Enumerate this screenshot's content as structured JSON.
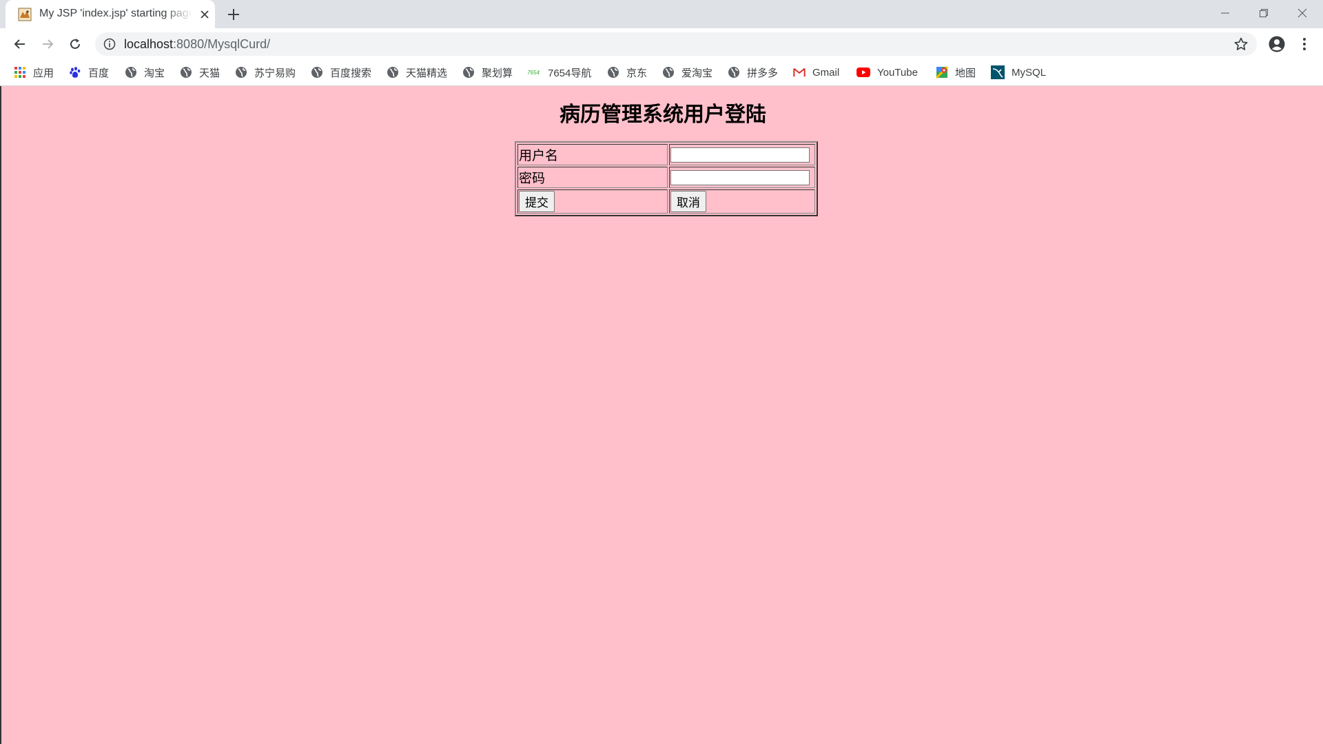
{
  "browser": {
    "tab": {
      "title": "My JSP 'index.jsp' starting page"
    },
    "address": {
      "host": "localhost",
      "path": ":8080/MysqlCurd/"
    },
    "bookmarks": [
      {
        "label": "应用",
        "icon": "apps-grid-icon"
      },
      {
        "label": "百度",
        "icon": "baidu-paw-icon"
      },
      {
        "label": "淘宝",
        "icon": "globe-icon"
      },
      {
        "label": "天猫",
        "icon": "globe-icon"
      },
      {
        "label": "苏宁易购",
        "icon": "globe-icon"
      },
      {
        "label": "百度搜索",
        "icon": "globe-icon"
      },
      {
        "label": "天猫精选",
        "icon": "globe-icon"
      },
      {
        "label": "聚划算",
        "icon": "globe-icon"
      },
      {
        "label": "7654导航",
        "icon": "7654-logo-icon",
        "icon_text": "7654"
      },
      {
        "label": "京东",
        "icon": "globe-icon"
      },
      {
        "label": "爱淘宝",
        "icon": "globe-icon"
      },
      {
        "label": "拼多多",
        "icon": "globe-icon"
      },
      {
        "label": "Gmail",
        "icon": "gmail-icon"
      },
      {
        "label": "YouTube",
        "icon": "youtube-icon"
      },
      {
        "label": "地图",
        "icon": "maps-icon"
      },
      {
        "label": "MySQL",
        "icon": "mysql-icon"
      }
    ]
  },
  "page": {
    "heading": "病历管理系统用户登陆",
    "form": {
      "username_label": "用户名",
      "password_label": "密码",
      "username_value": "",
      "password_value": "",
      "submit_label": "提交",
      "cancel_label": "取消"
    }
  },
  "colors": {
    "page_background": "#ffc0cb",
    "tabstrip": "#dee1e6",
    "omnibox": "#f1f3f4"
  }
}
